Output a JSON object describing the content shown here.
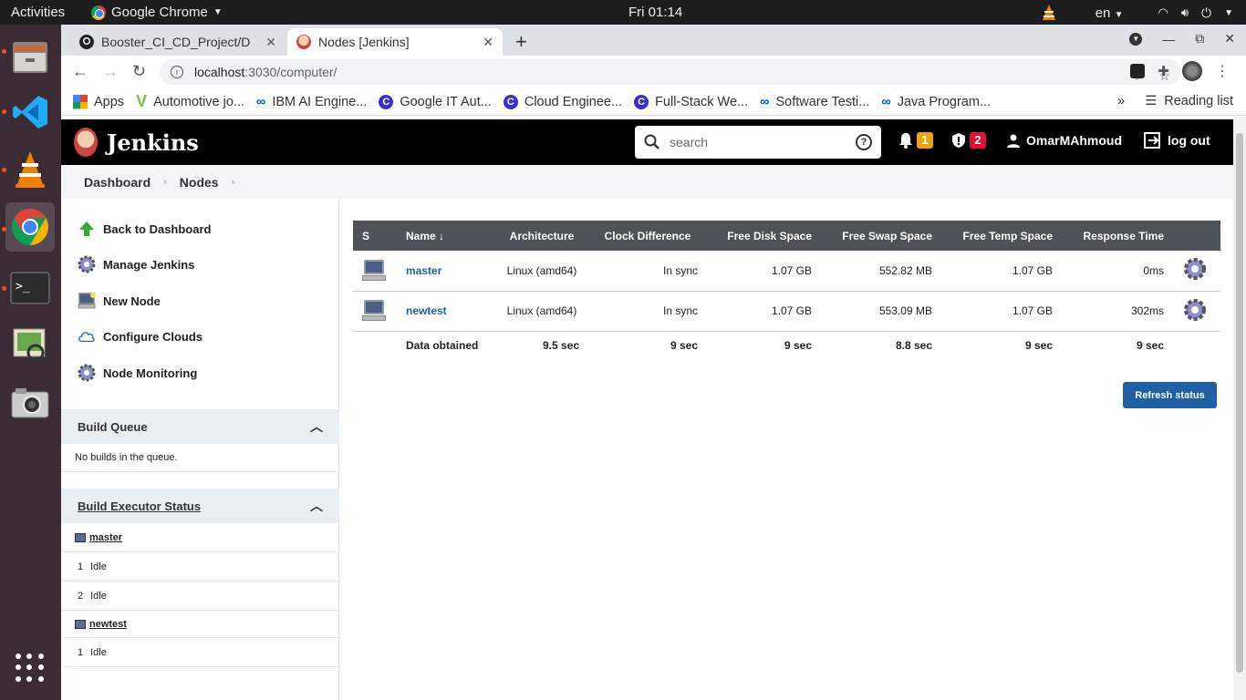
{
  "os": {
    "activities": "Activities",
    "app_name": "Google Chrome",
    "clock": "Fri 01:14",
    "language": "en"
  },
  "browser": {
    "tabs": [
      {
        "title": "Booster_CI_CD_Project/D"
      },
      {
        "title": "Nodes [Jenkins]"
      }
    ],
    "url_host": "localhost",
    "url_path": ":3030/computer/",
    "bookmarks": [
      {
        "label": "Apps"
      },
      {
        "label": "Automotive jo..."
      },
      {
        "label": "IBM AI Engine..."
      },
      {
        "label": "Google IT Aut..."
      },
      {
        "label": "Cloud Enginee..."
      },
      {
        "label": "Full-Stack We..."
      },
      {
        "label": "Software Testi..."
      },
      {
        "label": "Java Program..."
      }
    ],
    "reading_list": "Reading list"
  },
  "jenkins": {
    "logo": "Jenkins",
    "search_placeholder": "search",
    "notifications_count": "1",
    "security_count": "2",
    "user": "OmarMAhmoud",
    "logout": "log out",
    "breadcrumbs": [
      "Dashboard",
      "Nodes"
    ],
    "tasks": [
      {
        "label": "Back to Dashboard"
      },
      {
        "label": "Manage Jenkins"
      },
      {
        "label": "New Node"
      },
      {
        "label": "Configure Clouds"
      },
      {
        "label": "Node Monitoring"
      }
    ],
    "build_queue": {
      "title": "Build Queue",
      "empty": "No builds in the queue."
    },
    "executor_status": {
      "title": "Build Executor Status",
      "nodes": [
        {
          "name": "master",
          "executors": [
            {
              "num": "1",
              "state": "Idle"
            },
            {
              "num": "2",
              "state": "Idle"
            }
          ]
        },
        {
          "name": "newtest",
          "executors": [
            {
              "num": "1",
              "state": "Idle"
            }
          ]
        }
      ]
    },
    "table": {
      "headers": [
        "S",
        "Name ↓",
        "Architecture",
        "Clock Difference",
        "Free Disk Space",
        "Free Swap Space",
        "Free Temp Space",
        "Response Time"
      ],
      "rows": [
        {
          "name": "master",
          "arch": "Linux (amd64)",
          "clock": "In sync",
          "disk": "1.07 GB",
          "swap": "552.82 MB",
          "temp": "1.07 GB",
          "resp": "0ms"
        },
        {
          "name": "newtest",
          "arch": "Linux (amd64)",
          "clock": "In sync",
          "disk": "1.07 GB",
          "swap": "553.09 MB",
          "temp": "1.07 GB",
          "resp": "302ms"
        }
      ],
      "footer": {
        "label": "Data obtained",
        "arch": "9.5 sec",
        "clock": "9 sec",
        "disk": "9 sec",
        "swap": "8.8 sec",
        "temp": "9 sec",
        "resp": "9 sec"
      }
    },
    "refresh_button": "Refresh status"
  }
}
